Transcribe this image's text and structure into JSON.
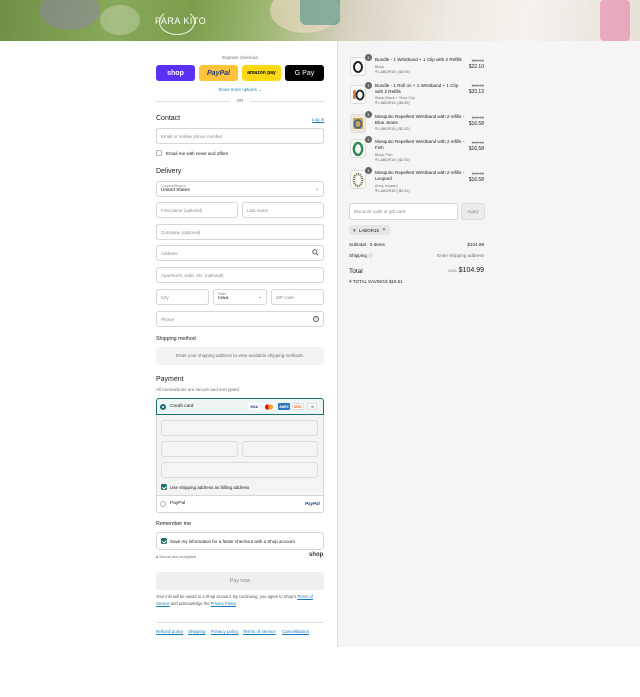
{
  "brand": {
    "logo_text": "PARA KITO"
  },
  "express": {
    "title": "Express checkout",
    "shop_label": "shop",
    "paypal_label": "PayPal",
    "amazon_label": "amazon pay",
    "gpay_label": "G Pay",
    "more_options": "Show more options",
    "or": "OR"
  },
  "contact": {
    "title": "Contact",
    "login_link": "Log in",
    "email_placeholder": "Email or mobile phone number",
    "newsletter_label": "Email me with news and offers",
    "newsletter_checked": false
  },
  "delivery": {
    "title": "Delivery",
    "country_label": "Country/Region",
    "country_value": "United States",
    "first_name": "First name (optional)",
    "last_name": "Last name",
    "company": "Company (optional)",
    "address": "Address",
    "apartment": "Apartment, suite, etc. (optional)",
    "city": "City",
    "state_label": "State",
    "state_value": "Iowa",
    "zip": "ZIP code",
    "phone": "Phone"
  },
  "shipping_method": {
    "title": "Shipping method",
    "notice": "Enter your shipping address to view available shipping methods."
  },
  "payment": {
    "title": "Payment",
    "subtitle": "All transactions are secure and encrypted.",
    "credit_card_label": "Credit card",
    "card_brands": [
      "VISA",
      "MC",
      "AMEX",
      "DISC"
    ],
    "more_cards": "+5",
    "billing_label": "Use shipping address as billing address",
    "billing_checked": true,
    "paypal_label": "PayPal",
    "paypal_logo": "PayPal"
  },
  "remember": {
    "title": "Remember me",
    "save_label": "Save my information for a faster checkout with a Shop account",
    "save_checked": true,
    "secure_note": "Secure and encrypted",
    "shop_logo": "shop"
  },
  "pay_now": {
    "label": "Pay now"
  },
  "legal": {
    "text1": "Your info will be saved to a Shop account. By continuing, you agree to Shop's",
    "terms": "Terms of Service",
    "text2": " and acknowledge the ",
    "privacy": "Privacy Policy",
    "end": "."
  },
  "footer_links": [
    "Refund policy",
    "Shipping",
    "Privacy policy",
    "Terms of service",
    "Cancellations"
  ],
  "cart": {
    "items": [
      {
        "qty": "1",
        "name": "Bundle - 1 Wristband + 1 Clip with 2 Refills",
        "variant": "Black",
        "discount": "LABOR15 (-$3.95)",
        "old_price": "$26.05",
        "price": "$22.10"
      },
      {
        "qty": "1",
        "name": "Bundle - 1 Roll on + 1 Wristband + 1 Clip with 2 Refills",
        "variant": "Black,Black + Terry Clip",
        "discount": "LABOR15 (-$5.85)",
        "old_price": "$38.98",
        "price": "$33.13"
      },
      {
        "qty": "1",
        "name": "Mosquito Repellent Wristband with 2 refills - Blue Jeans",
        "variant": "",
        "discount": "LABOR15 (-$2.92)",
        "old_price": "$19.50",
        "price": "$16.58"
      },
      {
        "qty": "1",
        "name": "Mosquito Repellent Wristband with 2 refills - Fish",
        "variant": "Black Fish",
        "discount": "LABOR15 (-$2.92)",
        "old_price": "$19.50",
        "price": "$16.58"
      },
      {
        "qty": "1",
        "name": "Mosquito Repellent Wristband with 2 refills - Leopard",
        "variant": "Army leopard",
        "discount": "LABOR15 (-$2.92)",
        "old_price": "$19.50",
        "price": "$16.58"
      }
    ],
    "discount_placeholder": "Discount code or gift card",
    "apply_label": "Apply",
    "applied_code": "LABOR15",
    "subtotal_label": "Subtotal · 5 items",
    "subtotal_value": "$104.99",
    "shipping_label": "Shipping",
    "shipping_value": "Enter shipping address",
    "total_label": "Total",
    "currency": "USD",
    "total_value": "$104.99",
    "savings_label": "TOTAL SAVINGS",
    "savings_value": "$18.51"
  },
  "colors": {
    "accent": "#1a6e6b",
    "shop_purple": "#5a31f4",
    "paypal_yellow": "#ffc439",
    "link": "#197bbd"
  }
}
